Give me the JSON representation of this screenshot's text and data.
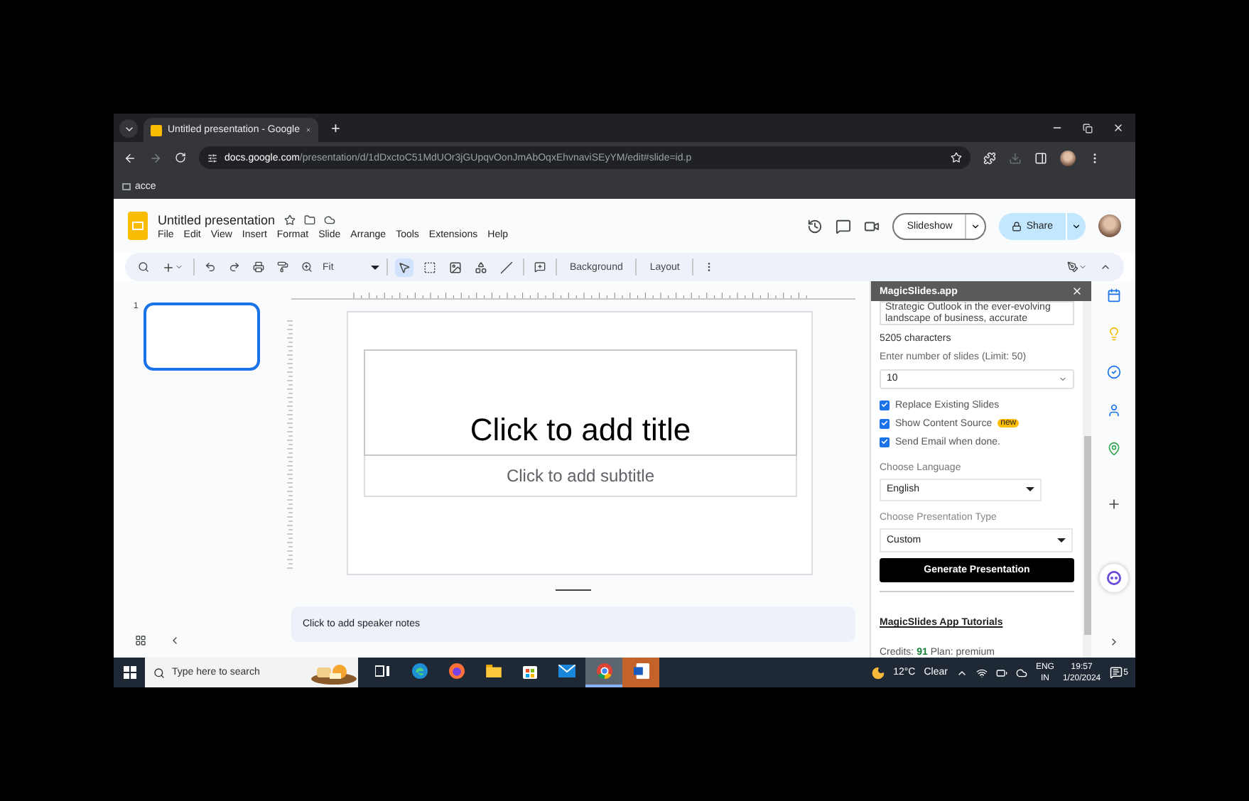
{
  "browser": {
    "tab": {
      "title": "Untitled presentation - Google",
      "selected": true
    },
    "new_tab": "+",
    "url": {
      "host": "docs.google.com",
      "path": "/presentation/d/1dDxctoC51MdUOr3jGUpqvOonJmAbOqxEhvnaviSEyYM/edit#slide=id.p"
    },
    "bookmarks": [
      {
        "label": "acce"
      }
    ]
  },
  "docs": {
    "title": "Untitled presentation",
    "menu": [
      "File",
      "Edit",
      "View",
      "Insert",
      "Format",
      "Slide",
      "Arrange",
      "Tools",
      "Extensions",
      "Help"
    ],
    "slideshow": "Slideshow",
    "share": "Share"
  },
  "toolbar": {
    "zoom": "Fit",
    "buttons": [
      "Background",
      "Layout"
    ],
    "tools": [
      {
        "kind": "select",
        "selected": true
      },
      {
        "kind": "textbox",
        "selected": false
      },
      {
        "kind": "image",
        "selected": false
      },
      {
        "kind": "shape",
        "selected": false
      },
      {
        "kind": "line",
        "selected": false
      }
    ]
  },
  "filmstrip": {
    "slides": [
      {
        "number": "1",
        "selected": true
      }
    ]
  },
  "slide": {
    "title_placeholder": "Click to add title",
    "subtitle_placeholder": "Click to add subtitle"
  },
  "notes": {
    "placeholder": "Click to add speaker notes"
  },
  "panel": {
    "title": "MagicSlides.app",
    "text": "Strategic Outlook in the ever-evolving landscape of business, accurate",
    "char_count": "5205 characters",
    "slides_label": "Enter number of slides (Limit: 50)",
    "slides_value": "10",
    "options": [
      {
        "label": "Replace Existing Slides",
        "checked": true
      },
      {
        "label": "Show Content Source",
        "checked": true,
        "badge": "new"
      },
      {
        "label": "Send Email when done.",
        "checked": true
      }
    ],
    "language_label": "Choose Language",
    "language": "English",
    "type_label": "Choose Presentation Type",
    "type": "Custom",
    "generate": "Generate Presentation",
    "tutorials": "MagicSlides App Tutorials",
    "credits_label": "Credits:",
    "credits": "91",
    "plan": "Plan: premium"
  },
  "taskbar": {
    "search_placeholder": "Type here to search",
    "apps": [
      {
        "kind": "taskview",
        "active": false,
        "attention": false
      },
      {
        "kind": "edge",
        "active": false,
        "attention": false
      },
      {
        "kind": "firefox",
        "active": false,
        "attention": false
      },
      {
        "kind": "explorer",
        "active": false,
        "attention": false
      },
      {
        "kind": "store",
        "active": false,
        "attention": false
      },
      {
        "kind": "mail",
        "active": false,
        "attention": false
      },
      {
        "kind": "chrome",
        "active": true,
        "attention": false
      },
      {
        "kind": "word",
        "active": false,
        "attention": true
      }
    ],
    "weather": {
      "temp": "12°C",
      "condition": "Clear"
    },
    "language": [
      "ENG",
      "IN"
    ],
    "time": "19:57",
    "date": "1/20/2024",
    "notifications": "5"
  }
}
